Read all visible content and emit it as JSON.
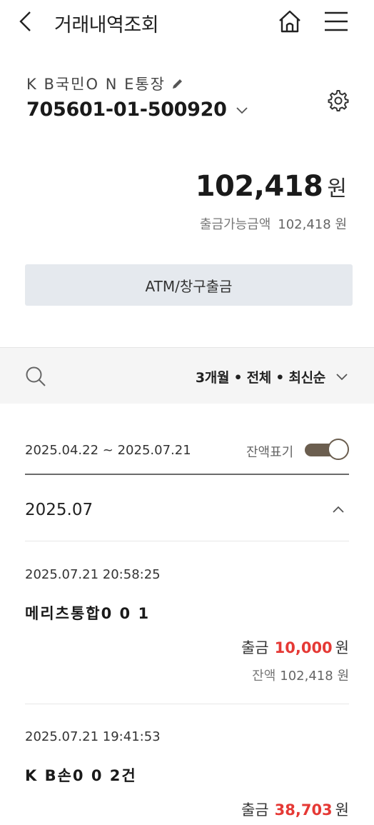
{
  "header": {
    "title": "거래내역조회"
  },
  "account": {
    "name": "K B국민O N E통장",
    "number": "705601-01-500920"
  },
  "balance": {
    "amount": "102,418",
    "unit": "원",
    "available_label": "출금가능금액",
    "available_value": "102,418 원"
  },
  "atm_button": "ATM/창구출금",
  "filter": {
    "label": "3개월 • 전체 • 최신순"
  },
  "range": {
    "text": "2025.04.22 ~ 2025.07.21",
    "toggle_label": "잔액표기",
    "toggle_on": true
  },
  "month": "2025.07",
  "transactions": [
    {
      "time": "2025.07.21 20:58:25",
      "name": "메리츠통합0 0 1",
      "kind": "출금",
      "amount": "10,000",
      "unit": "원",
      "balance_label": "잔액",
      "balance_value": "102,418 원"
    },
    {
      "time": "2025.07.21 19:41:53",
      "name": "K B손0 0 2건",
      "kind": "출금",
      "amount": "38,703",
      "unit": "원"
    }
  ],
  "colors": {
    "accent_red": "#e53935",
    "toggle": "#6b5e4f",
    "button_bg": "#e5e9ee"
  }
}
